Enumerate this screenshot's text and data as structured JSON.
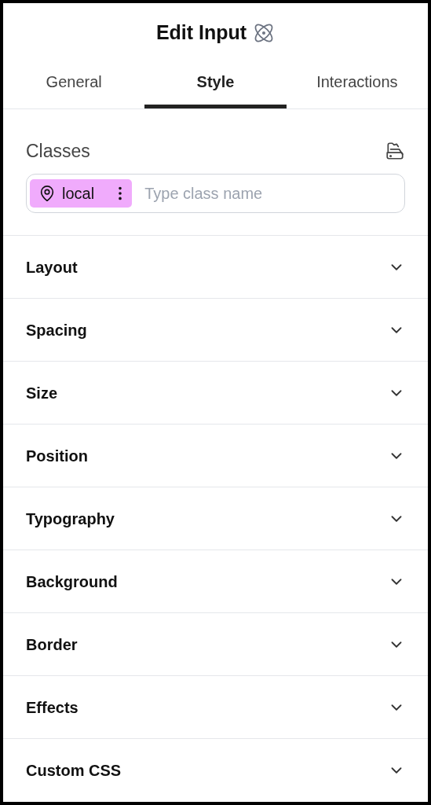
{
  "title": "Edit Input",
  "tabs": [
    {
      "label": "General",
      "selected": false
    },
    {
      "label": "Style",
      "selected": true
    },
    {
      "label": "Interactions",
      "selected": false
    }
  ],
  "classes": {
    "label": "Classes",
    "chips": [
      {
        "label": "local"
      }
    ],
    "placeholder": "Type class name"
  },
  "sections": [
    {
      "label": "Layout",
      "expanded": false
    },
    {
      "label": "Spacing",
      "expanded": false
    },
    {
      "label": "Size",
      "expanded": false
    },
    {
      "label": "Position",
      "expanded": false
    },
    {
      "label": "Typography",
      "expanded": false
    },
    {
      "label": "Background",
      "expanded": false
    },
    {
      "label": "Border",
      "expanded": false
    },
    {
      "label": "Effects",
      "expanded": false
    },
    {
      "label": "Custom CSS",
      "expanded": false
    }
  ]
}
